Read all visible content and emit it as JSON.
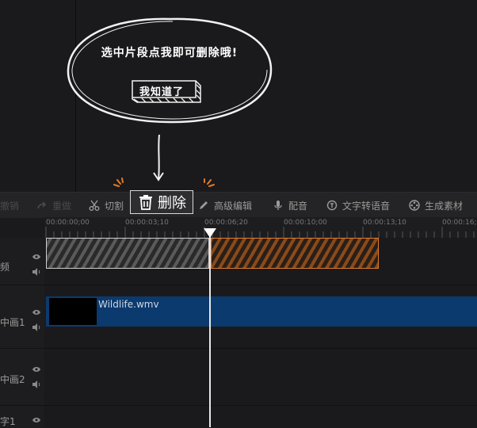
{
  "tutorial": {
    "message": "选中片段点我即可删除哦!",
    "confirm_label": "我知道了"
  },
  "toolbar": {
    "undo": "撤销",
    "redo": "重做",
    "cut": "切割",
    "delete": "删除",
    "advanced_edit": "高级编辑",
    "dub": "配音",
    "tts": "文字转语音",
    "generate": "生成素材"
  },
  "ruler": {
    "ticks": [
      "00:00:00;00",
      "00:00:03;10",
      "00:00:06;20",
      "00:00:10;00",
      "00:00:13;10",
      "00:00:16;"
    ]
  },
  "tracks": [
    {
      "name": "频"
    },
    {
      "name": "中画1"
    },
    {
      "name": "中画2"
    },
    {
      "name": "字1"
    }
  ],
  "clip": {
    "filename": "Wildlife.wmv"
  },
  "colors": {
    "accent": "#e07b2a",
    "video_clip": "#0b3a6e"
  }
}
